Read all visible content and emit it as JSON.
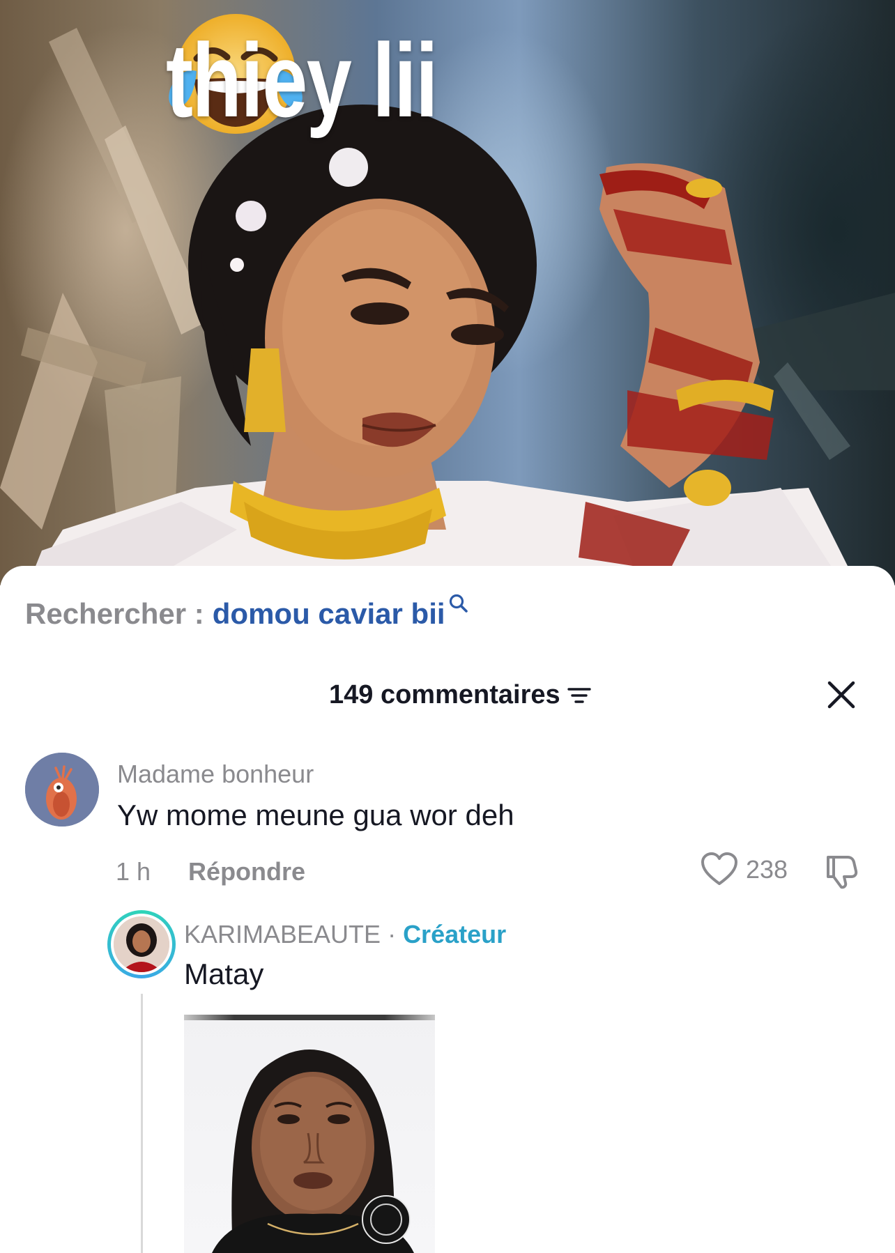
{
  "video": {
    "overlay_emoji": "😂",
    "overlay_text": "thiey lii"
  },
  "search": {
    "prefix": "Rechercher :",
    "term": "domou caviar bii"
  },
  "comments_header": {
    "count_label": "149 commentaires"
  },
  "comment": {
    "username": "Madame bonheur",
    "text": "Yw mome meune gua wor deh",
    "time": "1 h",
    "reply_label": "Répondre",
    "likes": "238"
  },
  "reply": {
    "username": "KARIMABEAUTE",
    "separator": "·",
    "badge": "Créateur",
    "text": "Matay"
  },
  "colors": {
    "link_blue": "#2b5aa8",
    "creator_teal": "#2aa1c8",
    "muted_gray": "#8a8a8e",
    "text_dark": "#161823"
  }
}
